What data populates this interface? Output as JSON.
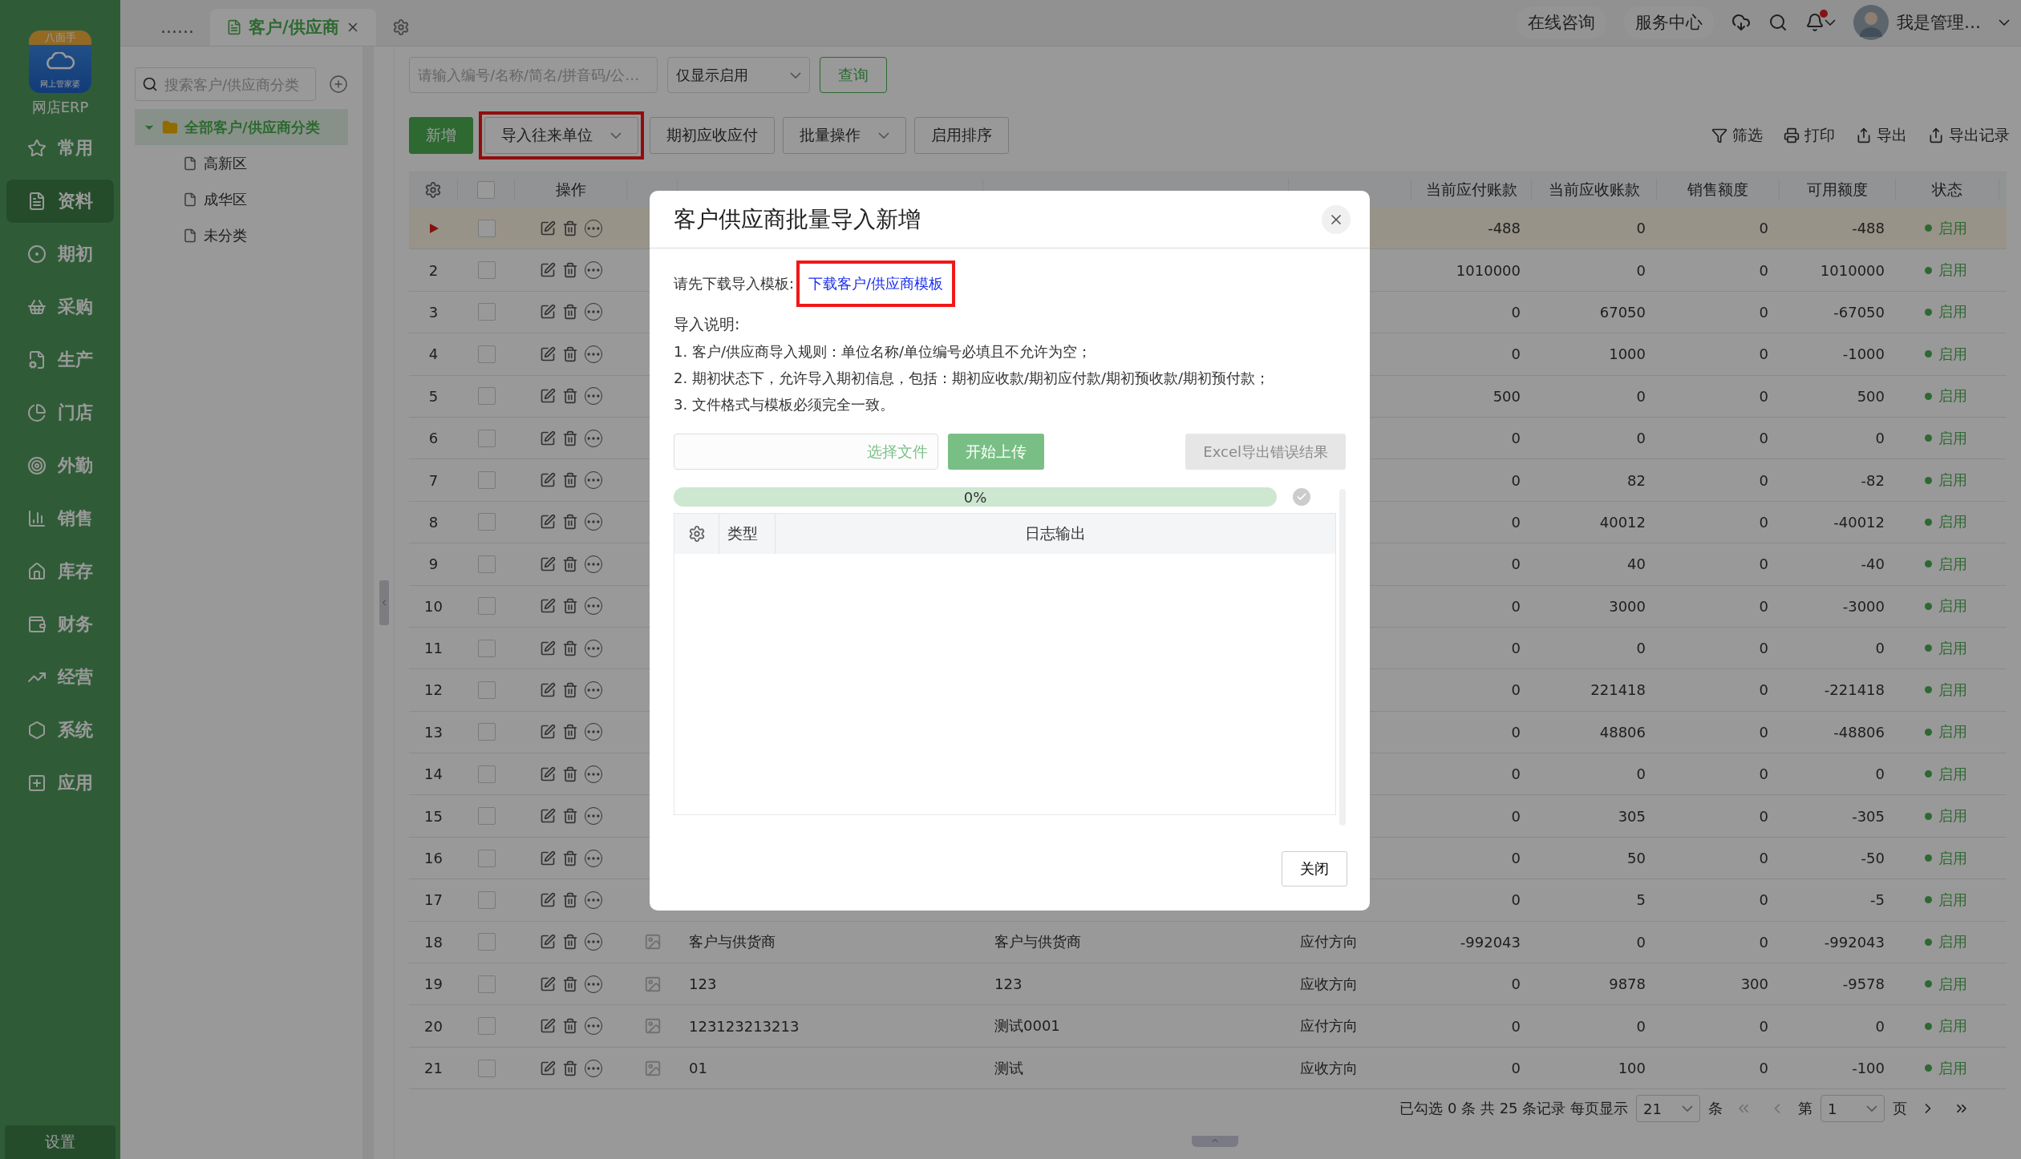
{
  "sidebar": {
    "logo": {
      "badge": "八面手",
      "caption": "网上管家婆",
      "name": "网店ERP"
    },
    "items": [
      {
        "label": "常用",
        "selected": false
      },
      {
        "label": "资料",
        "selected": true
      },
      {
        "label": "期初",
        "selected": false
      },
      {
        "label": "采购",
        "selected": false
      },
      {
        "label": "生产",
        "selected": false
      },
      {
        "label": "门店",
        "selected": false
      },
      {
        "label": "外勤",
        "selected": false
      },
      {
        "label": "销售",
        "selected": false
      },
      {
        "label": "库存",
        "selected": false
      },
      {
        "label": "财务",
        "selected": false
      },
      {
        "label": "经营",
        "selected": false
      },
      {
        "label": "系统",
        "selected": false
      },
      {
        "label": "应用",
        "selected": false
      }
    ],
    "settings": "设置"
  },
  "topbar": {
    "tabs": [
      {
        "label": "……",
        "selected": false,
        "closable": false
      },
      {
        "label": "客户/供应商",
        "selected": true,
        "closable": true
      }
    ],
    "links": [
      "在线咨询",
      "服务中心"
    ],
    "has_unread": true,
    "user": "我是管理…"
  },
  "categories": {
    "search_placeholder": "搜索客户/供应商分类",
    "tree": [
      {
        "label": "全部客户/供应商分类",
        "expanded": true,
        "selected": true,
        "children": [
          {
            "label": "高新区",
            "selected": false
          },
          {
            "label": "成华区",
            "selected": false
          },
          {
            "label": "未分类",
            "selected": false
          }
        ]
      }
    ]
  },
  "filter": {
    "placeholder": "请输入编号/名称/简名/拼音码/公…",
    "status_select": "仅显示启用",
    "query_button": "查询"
  },
  "toolbar": {
    "buttons": [
      {
        "label": "新增",
        "kind": "primary",
        "dropdown": false,
        "highlighted": false
      },
      {
        "label": "导入往来单位",
        "kind": "default",
        "dropdown": true,
        "highlighted": true
      },
      {
        "label": "期初应收应付",
        "kind": "default",
        "dropdown": false,
        "highlighted": false
      },
      {
        "label": "批量操作",
        "kind": "default",
        "dropdown": true,
        "highlighted": false
      },
      {
        "label": "启用排序",
        "kind": "default",
        "dropdown": false,
        "highlighted": false
      }
    ],
    "actions": [
      {
        "label": "筛选",
        "kind": "filter"
      },
      {
        "label": "打印",
        "kind": "print"
      },
      {
        "label": "导出",
        "kind": "export"
      },
      {
        "label": "导出记录",
        "kind": "export"
      }
    ]
  },
  "table": {
    "all_checked": false,
    "columns": [
      "操作",
      "当前应付账款",
      "当前应收账款",
      "销售额度",
      "可用额度",
      "状态"
    ],
    "rows": [
      {
        "selected": true,
        "checked": false,
        "payable": "-488",
        "receivable": "0",
        "sales_limit": "0",
        "available": "-488",
        "status": "启用"
      },
      {
        "no": "2",
        "selected": false,
        "checked": false,
        "payable": "1010000",
        "receivable": "0",
        "sales_limit": "0",
        "available": "1010000",
        "status": "启用"
      },
      {
        "no": "3",
        "selected": false,
        "checked": false,
        "payable": "0",
        "receivable": "67050",
        "sales_limit": "0",
        "available": "-67050",
        "status": "启用"
      },
      {
        "no": "4",
        "selected": false,
        "checked": false,
        "payable": "0",
        "receivable": "1000",
        "sales_limit": "0",
        "available": "-1000",
        "status": "启用"
      },
      {
        "no": "5",
        "selected": false,
        "checked": false,
        "payable": "500",
        "receivable": "0",
        "sales_limit": "0",
        "available": "500",
        "status": "启用"
      },
      {
        "no": "6",
        "selected": false,
        "checked": false,
        "payable": "0",
        "receivable": "0",
        "sales_limit": "0",
        "available": "0",
        "status": "启用"
      },
      {
        "no": "7",
        "selected": false,
        "checked": false,
        "payable": "0",
        "receivable": "82",
        "sales_limit": "0",
        "available": "-82",
        "status": "启用"
      },
      {
        "no": "8",
        "selected": false,
        "checked": false,
        "payable": "0",
        "receivable": "40012",
        "sales_limit": "0",
        "available": "-40012",
        "status": "启用"
      },
      {
        "no": "9",
        "selected": false,
        "checked": false,
        "payable": "0",
        "receivable": "40",
        "sales_limit": "0",
        "available": "-40",
        "status": "启用"
      },
      {
        "no": "10",
        "selected": false,
        "checked": false,
        "payable": "0",
        "receivable": "3000",
        "sales_limit": "0",
        "available": "-3000",
        "status": "启用"
      },
      {
        "no": "11",
        "selected": false,
        "checked": false,
        "payable": "0",
        "receivable": "0",
        "sales_limit": "0",
        "available": "0",
        "status": "启用"
      },
      {
        "no": "12",
        "selected": false,
        "checked": false,
        "payable": "0",
        "receivable": "221418",
        "sales_limit": "0",
        "available": "-221418",
        "status": "启用"
      },
      {
        "no": "13",
        "selected": false,
        "checked": false,
        "payable": "0",
        "receivable": "48806",
        "sales_limit": "0",
        "available": "-48806",
        "status": "启用"
      },
      {
        "no": "14",
        "selected": false,
        "checked": false,
        "payable": "0",
        "receivable": "0",
        "sales_limit": "0",
        "available": "0",
        "status": "启用"
      },
      {
        "no": "15",
        "selected": false,
        "checked": false,
        "payable": "0",
        "receivable": "305",
        "sales_limit": "0",
        "available": "-305",
        "status": "启用"
      },
      {
        "no": "16",
        "selected": false,
        "checked": false,
        "payable": "0",
        "receivable": "50",
        "sales_limit": "0",
        "available": "-50",
        "status": "启用"
      },
      {
        "no": "17",
        "selected": false,
        "checked": false,
        "payable": "0",
        "receivable": "5",
        "sales_limit": "0",
        "available": "-5",
        "status": "启用"
      },
      {
        "no": "18",
        "selected": false,
        "checked": false,
        "code": "客户与供货商",
        "name": "客户与供货商",
        "direction": "应付方向",
        "payable": "-992043",
        "receivable": "0",
        "sales_limit": "0",
        "available": "-992043",
        "status": "启用"
      },
      {
        "no": "19",
        "selected": false,
        "checked": false,
        "code": "123",
        "name": "123",
        "direction": "应收方向",
        "payable": "0",
        "receivable": "9878",
        "sales_limit": "300",
        "available": "-9578",
        "status": "启用"
      },
      {
        "no": "20",
        "selected": false,
        "checked": false,
        "code": "123123213213",
        "name": "测试0001",
        "direction": "应付方向",
        "payable": "0",
        "receivable": "0",
        "sales_limit": "0",
        "available": "0",
        "status": "启用"
      },
      {
        "no": "21",
        "selected": false,
        "checked": false,
        "code": "01",
        "name": "测试",
        "direction": "应收方向",
        "payable": "0",
        "receivable": "100",
        "sales_limit": "0",
        "available": "-100",
        "status": "启用"
      }
    ]
  },
  "pagination": {
    "summary": "已勾选 0 条 共 25 条记录 每页显示",
    "page_size": "21",
    "unit": "条",
    "page_prefix": "第",
    "page": "1",
    "page_suffix": "页",
    "nav": [
      {
        "kind": "first",
        "disabled": true
      },
      {
        "kind": "prev",
        "disabled": true
      },
      {
        "kind": "next",
        "disabled": false
      },
      {
        "kind": "last",
        "disabled": false
      }
    ]
  },
  "modal": {
    "title": "客户供应商批量导入新增",
    "template_label": "请先下载导入模板:",
    "template_link": "下载客户/供应商模板",
    "template_highlighted": true,
    "notes_title": "导入说明:",
    "notes": [
      "1. 客户/供应商导入规则：单位名称/单位编号必填且不允许为空；",
      "2. 期初状态下，允许导入期初信息，包括：期初应收款/期初应付款/期初预收款/期初预付款；",
      "3. 文件格式与模板必须完全一致。"
    ],
    "file_button": "选择文件",
    "upload_button": "开始上传",
    "export_button": {
      "label": "Excel导出错误结果",
      "disabled": true
    },
    "progress": {
      "level": 0,
      "label": "0%"
    },
    "log_columns": [
      "类型",
      "日志输出"
    ],
    "close_button": "关闭"
  }
}
